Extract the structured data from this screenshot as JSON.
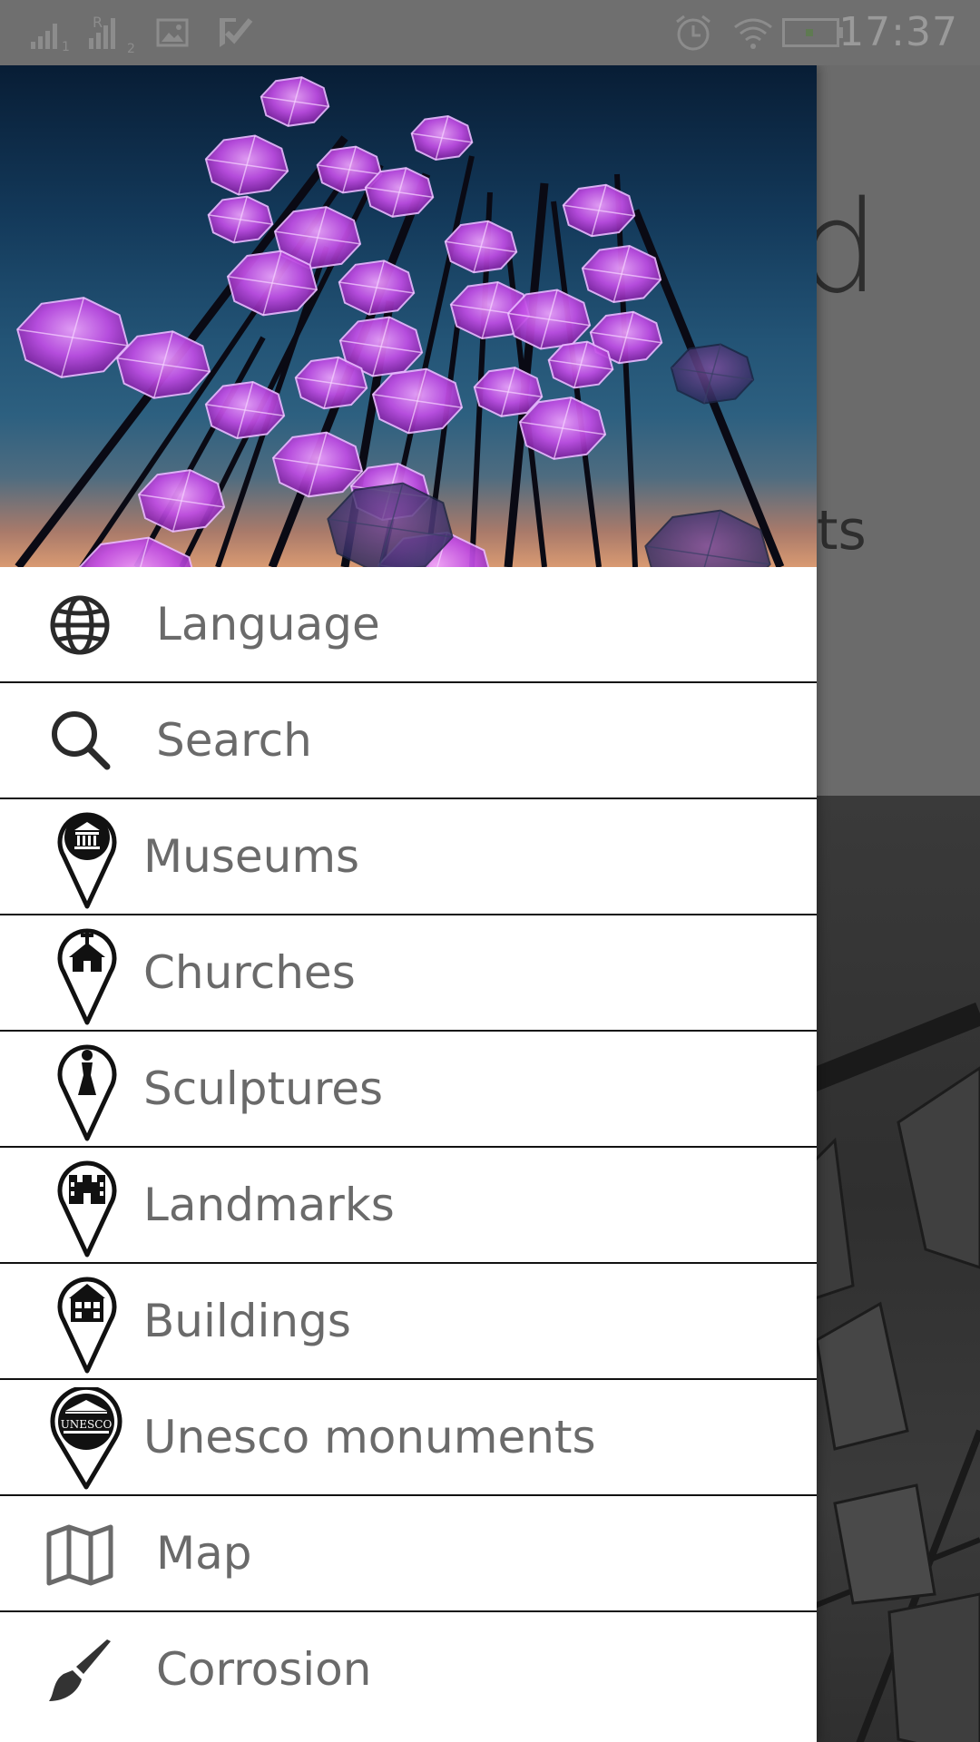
{
  "status_bar": {
    "time": "17:37",
    "sim1_label": "1",
    "sim2_label": "2",
    "sim2_roaming": "R"
  },
  "background_page": {
    "heading_fragment": "d",
    "subtitle_fragment": "nts"
  },
  "drawer": {
    "header_image_icon": "umbrellas-photo",
    "items": [
      {
        "label": "Language",
        "icon": "globe-icon"
      },
      {
        "label": "Search",
        "icon": "search-icon"
      },
      {
        "label": "Museums",
        "icon": "museum-pin-icon"
      },
      {
        "label": "Churches",
        "icon": "church-pin-icon"
      },
      {
        "label": "Sculptures",
        "icon": "sculpture-pin-icon"
      },
      {
        "label": "Landmarks",
        "icon": "landmark-pin-icon"
      },
      {
        "label": "Buildings",
        "icon": "building-pin-icon"
      },
      {
        "label": "Unesco monuments",
        "icon": "unesco-pin-icon"
      },
      {
        "label": "Map",
        "icon": "map-icon"
      },
      {
        "label": "Corrosion",
        "icon": "brush-icon"
      }
    ],
    "unesco_emblem_text": "UNESCO"
  },
  "colors": {
    "drawer_bg": "#ffffff",
    "label": "#6a6a6a",
    "divider": "#111111",
    "scrim": "#6b6b6b",
    "umbrella": "#c24de6"
  }
}
